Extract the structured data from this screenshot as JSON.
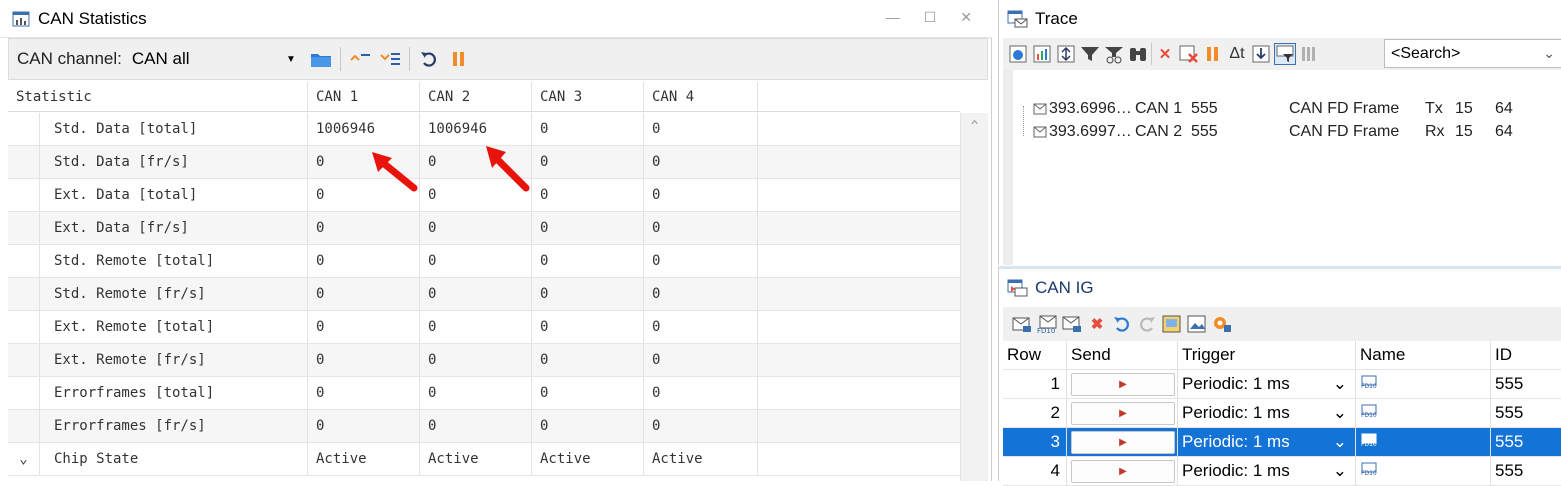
{
  "stats": {
    "title": "CAN Statistics",
    "win_controls": [
      "—",
      "☐",
      "✕"
    ],
    "channel_label": "CAN channel:",
    "channel_value": "CAN all",
    "columns": [
      "Statistic",
      "CAN 1",
      "CAN 2",
      "CAN 3",
      "CAN 4"
    ],
    "rows": [
      {
        "name": "Std. Data [total]",
        "v": [
          "1006946",
          "1006946",
          "0",
          "0"
        ]
      },
      {
        "name": "Std. Data [fr/s]",
        "v": [
          "0",
          "0",
          "0",
          "0"
        ]
      },
      {
        "name": "Ext. Data [total]",
        "v": [
          "0",
          "0",
          "0",
          "0"
        ]
      },
      {
        "name": "Ext. Data [fr/s]",
        "v": [
          "0",
          "0",
          "0",
          "0"
        ]
      },
      {
        "name": "Std. Remote [total]",
        "v": [
          "0",
          "0",
          "0",
          "0"
        ]
      },
      {
        "name": "Std. Remote [fr/s]",
        "v": [
          "0",
          "0",
          "0",
          "0"
        ]
      },
      {
        "name": "Ext. Remote [total]",
        "v": [
          "0",
          "0",
          "0",
          "0"
        ]
      },
      {
        "name": "Ext. Remote [fr/s]",
        "v": [
          "0",
          "0",
          "0",
          "0"
        ]
      },
      {
        "name": "Errorframes [total]",
        "v": [
          "0",
          "0",
          "0",
          "0"
        ]
      },
      {
        "name": "Errorframes [fr/s]",
        "v": [
          "0",
          "0",
          "0",
          "0"
        ]
      },
      {
        "name": "Chip State",
        "v": [
          "Active",
          "Active",
          "Active",
          "Active"
        ],
        "expander": "⌄"
      }
    ],
    "scroll_up": "^"
  },
  "trace": {
    "title": "Trace",
    "search_placeholder": "<Search>",
    "rows": [
      {
        "time": "393.6996…",
        "chan": "CAN 1",
        "id": "555",
        "type": "CAN FD Frame",
        "dir": "Tx",
        "dlc": "15",
        "len": "64"
      },
      {
        "time": "393.6997…",
        "chan": "CAN 2",
        "id": "555",
        "type": "CAN FD Frame",
        "dir": "Rx",
        "dlc": "15",
        "len": "64"
      }
    ]
  },
  "canig": {
    "title": "CAN IG",
    "columns": [
      "Row",
      "Send",
      "Trigger",
      "Name",
      "ID"
    ],
    "rows": [
      {
        "row": "1",
        "trigger": "Periodic: 1 ms",
        "id": "555"
      },
      {
        "row": "2",
        "trigger": "Periodic: 1 ms",
        "id": "555"
      },
      {
        "row": "3",
        "trigger": "Periodic: 1 ms",
        "id": "555"
      },
      {
        "row": "4",
        "trigger": "Periodic: 1 ms",
        "id": "555"
      }
    ],
    "selected_row": "3"
  },
  "colors": {
    "selection": "#1473d6",
    "accent_orange": "#f28c28",
    "stop_red": "#e74c3c",
    "arrow_red": "#e8140c"
  }
}
